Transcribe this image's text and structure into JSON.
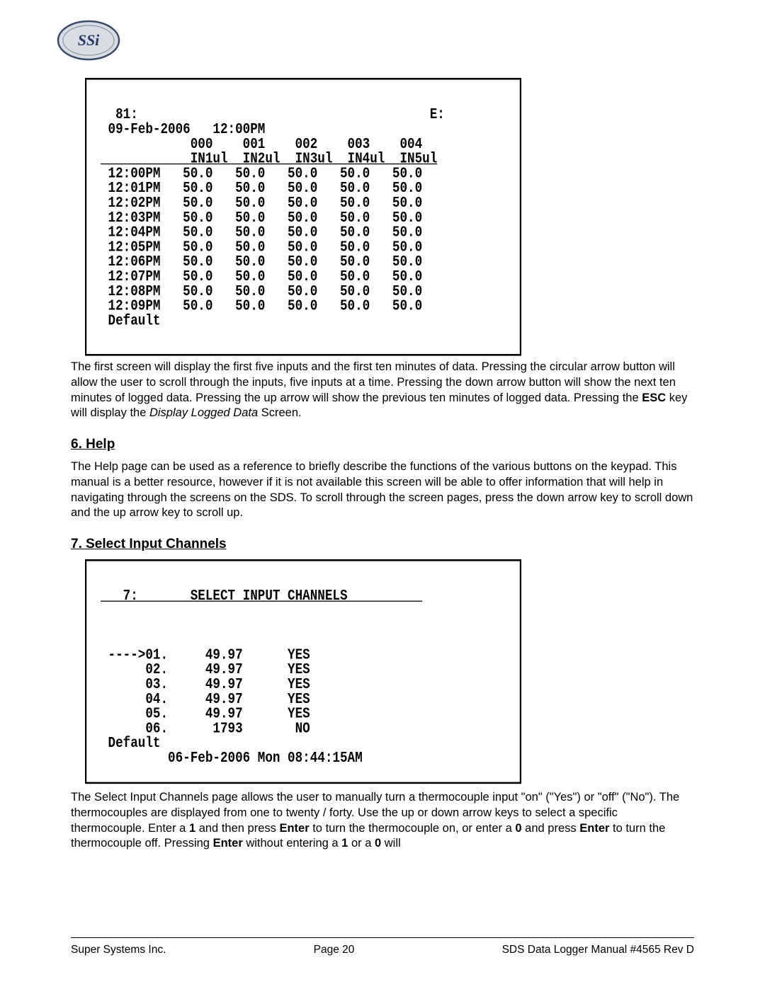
{
  "term81": {
    "l0": "  81:                                       E:",
    "l1": " 09-Feb-2006   12:00PM",
    "l2": "            000    001    002    003    004",
    "l3": "            IN1ul  IN2ul  IN3ul  IN4ul  IN5ul",
    "l4": " 12:00PM   50.0   50.0   50.0   50.0   50.0",
    "l5": " 12:01PM   50.0   50.0   50.0   50.0   50.0",
    "l6": " 12:02PM   50.0   50.0   50.0   50.0   50.0",
    "l7": " 12:03PM   50.0   50.0   50.0   50.0   50.0",
    "l8": " 12:04PM   50.0   50.0   50.0   50.0   50.0",
    "l9": " 12:05PM   50.0   50.0   50.0   50.0   50.0",
    "l10": " 12:06PM   50.0   50.0   50.0   50.0   50.0",
    "l11": " 12:07PM   50.0   50.0   50.0   50.0   50.0",
    "l12": " 12:08PM   50.0   50.0   50.0   50.0   50.0",
    "l13": " 12:09PM   50.0   50.0   50.0   50.0   50.0",
    "l14": " Default"
  },
  "para1": {
    "a": "The first screen will display the first five inputs and the first ten minutes of data.  Pressing the circular arrow button will allow the user to scroll through the inputs, five inputs at a time.  Pressing the down arrow button will show the next ten minutes of logged data.  Pressing the up arrow will show the previous ten minutes of logged data.  Pressing the ",
    "b": "ESC",
    "c": " key will display the ",
    "d": "Display Logged Data",
    "e": " Screen."
  },
  "headings": {
    "h6": "6. Help",
    "h7": "7. Select Input Channels"
  },
  "para2": "The Help page can be used as a reference to briefly describe the functions of the various buttons on the keypad.  This manual is a better resource, however if it is not available this screen will be able to offer information that will help in navigating through the screens on the SDS.  To scroll through the screen pages, press the down arrow key to scroll down and the up arrow key to scroll up.",
  "term7": {
    "l0": "   7:       SELECT INPUT CHANNELS          ",
    "l1": "",
    "l2": "",
    "l3": "",
    "l4": " ---->01.     49.97      YES",
    "l5": "      02.     49.97      YES",
    "l6": "      03.     49.97      YES",
    "l7": "      04.     49.97      YES",
    "l8": "      05.     49.97      YES",
    "l9": "      06.      1793       NO",
    "l10": " Default",
    "l11": "         06-Feb-2006 Mon 08:44:15AM"
  },
  "para3": {
    "a": "The Select Input Channels page allows the user to manually turn a thermocouple input \"on\" (\"Yes\") or \"off\" (\"No\").  The thermocouples are displayed from one to twenty / forty.  Use the up or down arrow keys to select a specific thermocouple.  Enter a ",
    "b": "1",
    "c": " and then press ",
    "d": "Enter",
    "e": " to turn the thermocouple on, or enter a ",
    "f": "0",
    "g": " and press ",
    "h": "Enter",
    "i": " to turn the thermocouple off.  Pressing ",
    "j": "Enter",
    "k": " without entering a ",
    "l": "1",
    "m": " or a ",
    "n": "0",
    "o": " will"
  },
  "footer": {
    "left": "Super Systems Inc.",
    "center": "Page 20",
    "right": "SDS Data Logger Manual #4565 Rev D"
  }
}
